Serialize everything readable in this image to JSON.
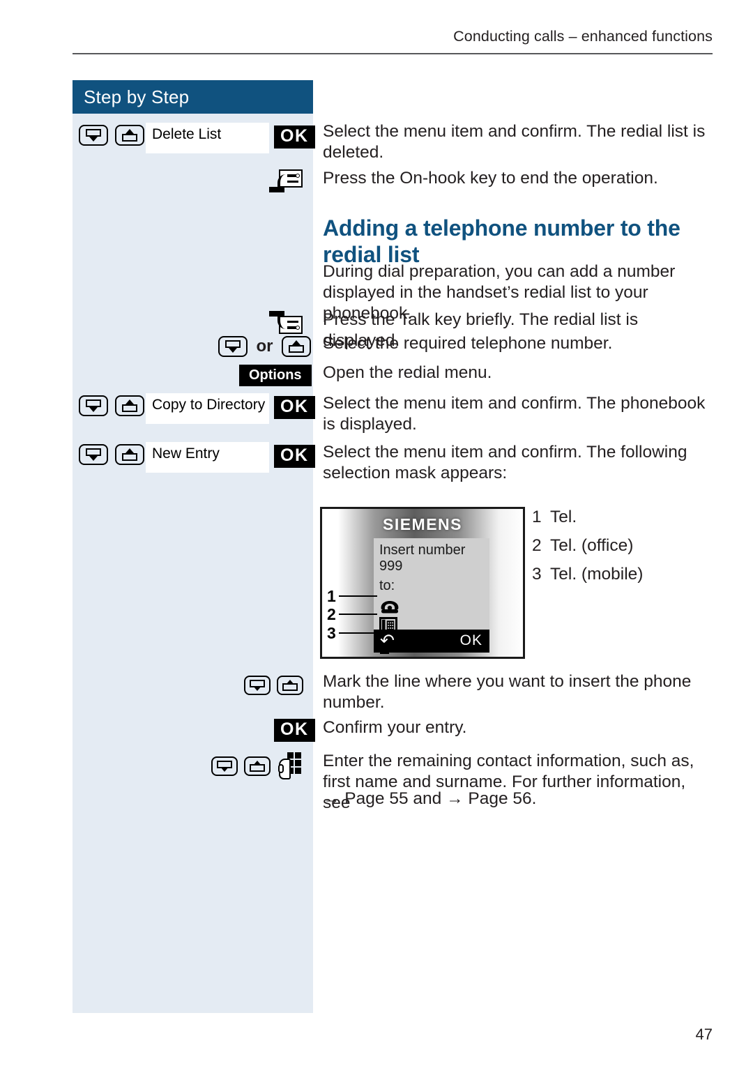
{
  "header": {
    "running_title": "Conducting calls – enhanced functions"
  },
  "sidebar": {
    "title": "Step by Step"
  },
  "steps": [
    {
      "keys": [
        "scroll-down-key",
        "scroll-up-key"
      ],
      "menu_field": "Delete List",
      "confirm": "OK",
      "text": "Select the menu item and confirm. The redial list is deleted."
    },
    {
      "keys": [
        "on-hook-key"
      ],
      "text": "Press the On-hook key to end the operation."
    },
    {
      "keys": [
        "talk-key"
      ],
      "text": "Press the Talk key briefly. The redial list is displayed."
    },
    {
      "keys": [
        "scroll-down-key",
        "scroll-up-key"
      ],
      "separator": "or",
      "text": "Select the required telephone number."
    },
    {
      "keys": [
        "options-softkey"
      ],
      "softkey_label": "Options",
      "text": "Open the redial menu."
    },
    {
      "keys": [
        "scroll-down-key",
        "scroll-up-key"
      ],
      "menu_field": "Copy to Directory",
      "confirm": "OK",
      "text": "Select the menu item and confirm. The phonebook is displayed."
    },
    {
      "keys": [
        "scroll-down-key",
        "scroll-up-key"
      ],
      "menu_field": "New Entry",
      "confirm": "OK",
      "text": "Select the menu item and confirm. The following selection mask appears:"
    },
    {
      "keys": [
        "scroll-down-key",
        "scroll-up-key"
      ],
      "text": "Mark the line where you want to insert the phone number."
    },
    {
      "keys": [
        "ok-key"
      ],
      "confirm": "OK",
      "text": "Confirm your entry."
    },
    {
      "keys": [
        "scroll-down-key",
        "scroll-up-key",
        "keypad-key"
      ],
      "text": "Enter the remaining contact information, such as, first name and surname. For further information, see",
      "refs": "→ Page 55 and → Page 56."
    }
  ],
  "section": {
    "heading": "Adding a telephone number to the redial list",
    "intro": "During dial preparation, you can add a number displayed in the handset’s redial list to your phonebook."
  },
  "figure": {
    "brand": "SIEMENS",
    "lcd_line1": "Insert number",
    "lcd_line2": "999",
    "lcd_line3": "to:",
    "softkey_left": "↶",
    "softkey_right": "OK",
    "callouts": [
      "1",
      "2",
      "3"
    ],
    "entry_icons": [
      "telephone-icon",
      "office-phone-icon",
      "mobile-phone-icon"
    ]
  },
  "legend": [
    {
      "num": "1",
      "label": "Tel."
    },
    {
      "num": "2",
      "label": "Tel. (office)"
    },
    {
      "num": "3",
      "label": "Tel. (mobile)"
    }
  ],
  "footer": {
    "page_number": "47"
  },
  "colors": {
    "accent_blue": "#10527f",
    "sidebar_bg": "#e4ebf3",
    "text": "#231f20"
  }
}
